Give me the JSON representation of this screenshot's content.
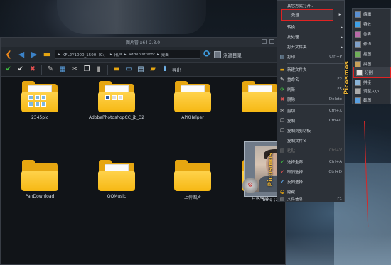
{
  "window": {
    "title": "图片管 x64 2.3.0",
    "address": [
      "KFL2Y1000_1500（C:）",
      "用户",
      "Administrator",
      "桌面"
    ],
    "tree_toggle_label": "浮遮目录",
    "export_label": "导出"
  },
  "files": [
    {
      "name": "2345pic"
    },
    {
      "name": "AdobePhotoshopCC_jb_32"
    },
    {
      "name": "APKHelper"
    },
    {
      "name": "PanDownload"
    },
    {
      "name": "QQMusic"
    },
    {
      "name": "上传图片"
    },
    {
      "name": "百度硬盘"
    }
  ],
  "selected_file": {
    "name": "timg (1).jpg"
  },
  "context_menu": {
    "items": [
      {
        "label": "其它方式打开...",
        "shortcut": "",
        "has_sub": false
      },
      {
        "label": "处理",
        "shortcut": "",
        "has_sub": true,
        "highlight": true
      },
      {
        "label": "转换",
        "shortcut": "",
        "has_sub": true
      },
      {
        "label": "批处理",
        "shortcut": "",
        "has_sub": true
      },
      {
        "label": "打开文件夹",
        "shortcut": "",
        "has_sub": true
      },
      {
        "label": "打印",
        "shortcut": "Ctrl+P",
        "has_sub": false
      },
      {
        "label": "新建文件夹",
        "shortcut": "",
        "has_sub": false
      },
      {
        "label": "重命名",
        "shortcut": "F2",
        "has_sub": false
      },
      {
        "label": "刷新",
        "shortcut": "F5",
        "has_sub": false
      },
      {
        "label": "删除",
        "shortcut": "Delete",
        "has_sub": false
      },
      {
        "label": "剪切",
        "shortcut": "Ctrl+X",
        "has_sub": false
      },
      {
        "label": "复制",
        "shortcut": "Ctrl+C",
        "has_sub": false
      },
      {
        "label": "复制到剪切板",
        "shortcut": "",
        "has_sub": false
      },
      {
        "label": "复制文件名",
        "shortcut": "",
        "has_sub": false
      },
      {
        "label": "粘贴",
        "shortcut": "Ctrl+V",
        "has_sub": false
      },
      {
        "label": "选择全部",
        "shortcut": "Ctrl+A",
        "has_sub": false
      },
      {
        "label": "取消选择",
        "shortcut": "Ctrl+D",
        "has_sub": false
      },
      {
        "label": "反向选择",
        "shortcut": "",
        "has_sub": false
      },
      {
        "label": "隐藏",
        "shortcut": "",
        "has_sub": false
      },
      {
        "label": "文件信息",
        "shortcut": "F1",
        "has_sub": false
      }
    ]
  },
  "submenu": {
    "items": [
      {
        "label": "编辑"
      },
      {
        "label": "特效"
      },
      {
        "label": "美容"
      },
      {
        "label": "修饰"
      },
      {
        "label": "抠图"
      },
      {
        "label": "拼图"
      },
      {
        "label": "分割",
        "highlight": true
      },
      {
        "label": "拼接"
      },
      {
        "label": "调整大小"
      },
      {
        "label": "截图"
      }
    ]
  },
  "brand": {
    "name": "Picosmos"
  },
  "colors": {
    "accent": "#e6a611",
    "highlight_outline": "#e02323"
  }
}
